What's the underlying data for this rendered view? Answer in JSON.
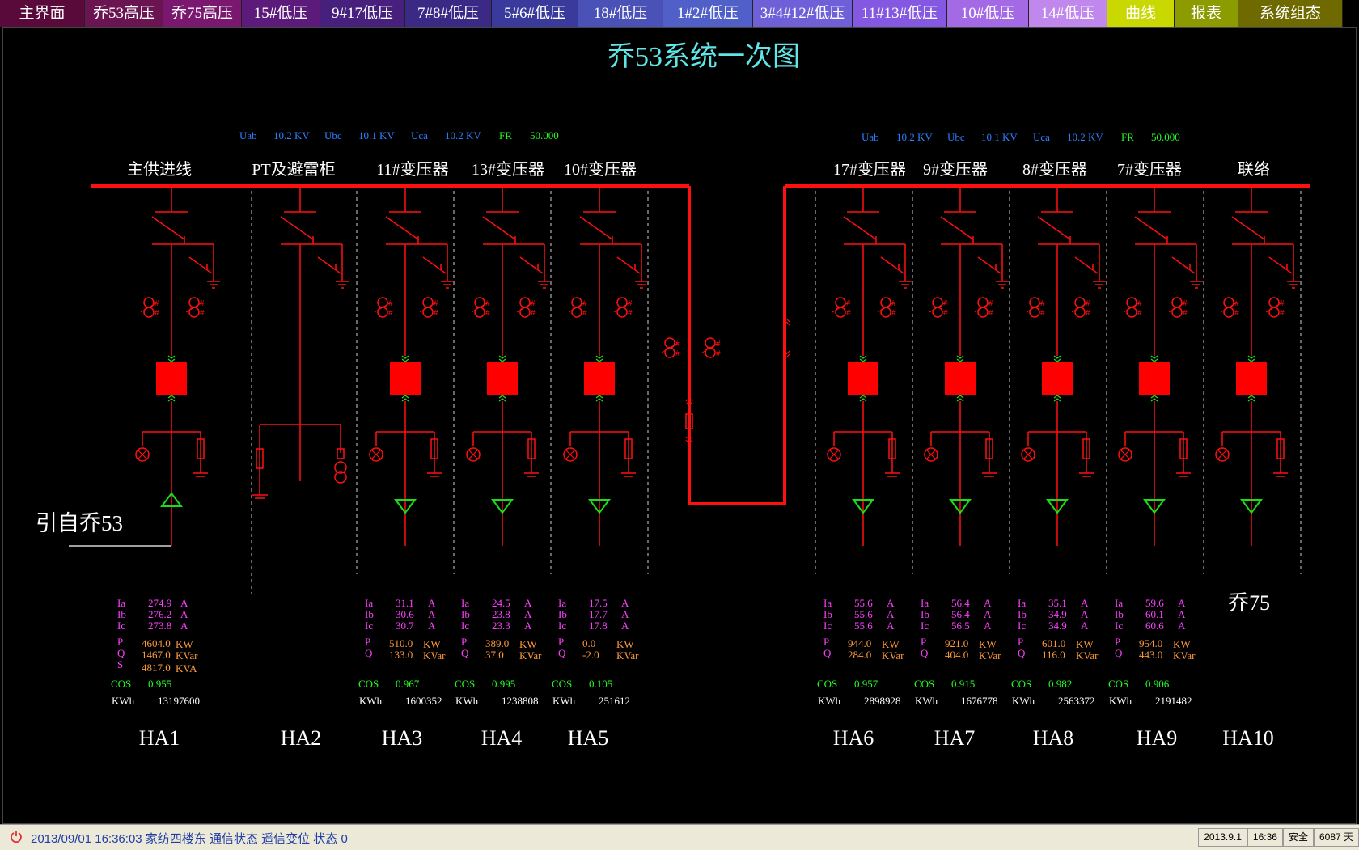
{
  "nav": {
    "tabs": [
      {
        "label": "主界面",
        "bg": "#5a0a3a"
      },
      {
        "label": "乔53高压",
        "bg": "#6a1552"
      },
      {
        "label": "乔75高压",
        "bg": "#7a1870"
      },
      {
        "label": "15#低压",
        "bg": "#5c1a7a"
      },
      {
        "label": "9#17低压",
        "bg": "#47207e"
      },
      {
        "label": "7#8#低压",
        "bg": "#3a2a86"
      },
      {
        "label": "5#6#低压",
        "bg": "#3a3a9c"
      },
      {
        "label": "18#低压",
        "bg": "#4a52b8"
      },
      {
        "label": "1#2#低压",
        "bg": "#5060c8"
      },
      {
        "label": "3#4#12#低压",
        "bg": "#7060d8"
      },
      {
        "label": "11#13#低压",
        "bg": "#8458e0"
      },
      {
        "label": "10#低压",
        "bg": "#a46ae6"
      },
      {
        "label": "14#低压",
        "bg": "#c088ec"
      },
      {
        "label": "曲线",
        "bg": "#c8d800"
      },
      {
        "label": "报表",
        "bg": "#8c9c00"
      },
      {
        "label": "系统组态",
        "bg": "#6e6a00"
      }
    ]
  },
  "title": "乔53系统一次图",
  "bus_left_meas": {
    "uab_label": "Uab",
    "uab": "10.2 KV",
    "ubc_label": "Ubc",
    "ubc": "10.1 KV",
    "uca_label": "Uca",
    "uca": "10.2 KV",
    "fr_label": "FR",
    "fr": "50.000"
  },
  "bus_right_meas": {
    "uab_label": "Uab",
    "uab": "10.2 KV",
    "ubc_label": "Ubc",
    "ubc": "10.1 KV",
    "uca_label": "Uca",
    "uca": "10.2 KV",
    "fr_label": "FR",
    "fr": "50.000"
  },
  "feeder_labels": [
    "主供进线",
    "PT及避雷柜",
    "11#变压器",
    "13#变压器",
    "10#变压器",
    "17#变压器",
    "9#变压器",
    "8#变压器",
    "7#变压器",
    "联络"
  ],
  "incoming_label": "引自乔53",
  "tie_label": "乔75",
  "units": {
    "a": "A",
    "kw": "KW",
    "kvar": "KVar",
    "kva": "KVA"
  },
  "row_labels": {
    "ia": "Ia",
    "ib": "Ib",
    "ic": "Ic",
    "p": "P",
    "q": "Q",
    "s": "S",
    "cos": "COS",
    "kwh": "KWh"
  },
  "panels": [
    {
      "id": "HA1",
      "ia": "274.9",
      "ib": "276.2",
      "ic": "273.8",
      "p": "4604.0",
      "q": "1467.0",
      "s": "4817.0",
      "cos": "0.955",
      "kwh": "13197600"
    },
    {
      "id": "HA3",
      "ia": "31.1",
      "ib": "30.6",
      "ic": "30.7",
      "p": "510.0",
      "q": "133.0",
      "cos": "0.967",
      "kwh": "1600352"
    },
    {
      "id": "HA4",
      "ia": "24.5",
      "ib": "23.8",
      "ic": "23.3",
      "p": "389.0",
      "q": "37.0",
      "cos": "0.995",
      "kwh": "1238808"
    },
    {
      "id": "HA5",
      "ia": "17.5",
      "ib": "17.7",
      "ic": "17.8",
      "p": "0.0",
      "q": "-2.0",
      "cos": "0.105",
      "kwh": "251612"
    },
    {
      "id": "HA6",
      "ia": "55.6",
      "ib": "55.6",
      "ic": "55.6",
      "p": "944.0",
      "q": "284.0",
      "cos": "0.957",
      "kwh": "2898928"
    },
    {
      "id": "HA7",
      "ia": "56.4",
      "ib": "56.4",
      "ic": "56.5",
      "p": "921.0",
      "q": "404.0",
      "cos": "0.915",
      "kwh": "1676778"
    },
    {
      "id": "HA8",
      "ia": "35.1",
      "ib": "34.9",
      "ic": "34.9",
      "p": "601.0",
      "q": "116.0",
      "cos": "0.982",
      "kwh": "2563372"
    },
    {
      "id": "HA9",
      "ia": "59.6",
      "ib": "60.1",
      "ic": "60.6",
      "p": "954.0",
      "q": "443.0",
      "cos": "0.906",
      "kwh": "2191482"
    }
  ],
  "ha_labels": [
    "HA1",
    "HA2",
    "HA3",
    "HA4",
    "HA5",
    "HA6",
    "HA7",
    "HA8",
    "HA9",
    "HA10"
  ],
  "status": {
    "message": "2013/09/01 16:36:03 家纺四楼东 通信状态 遥信变位 状态 0",
    "date": "2013.9.1",
    "time": "16:36",
    "safety": "安全",
    "days": "6087 天"
  },
  "colors": {
    "line": "#ff1010",
    "breaker": "#ff0000",
    "load_triangle": "#18e018",
    "title": "#5fe6e6",
    "meas_blue": "#2d7fff",
    "meas_green": "#22ff22",
    "current_label": "#ff40ff",
    "power": "#ff9a3c",
    "cos": "#22ff22",
    "divider": "#cfcfcf"
  }
}
